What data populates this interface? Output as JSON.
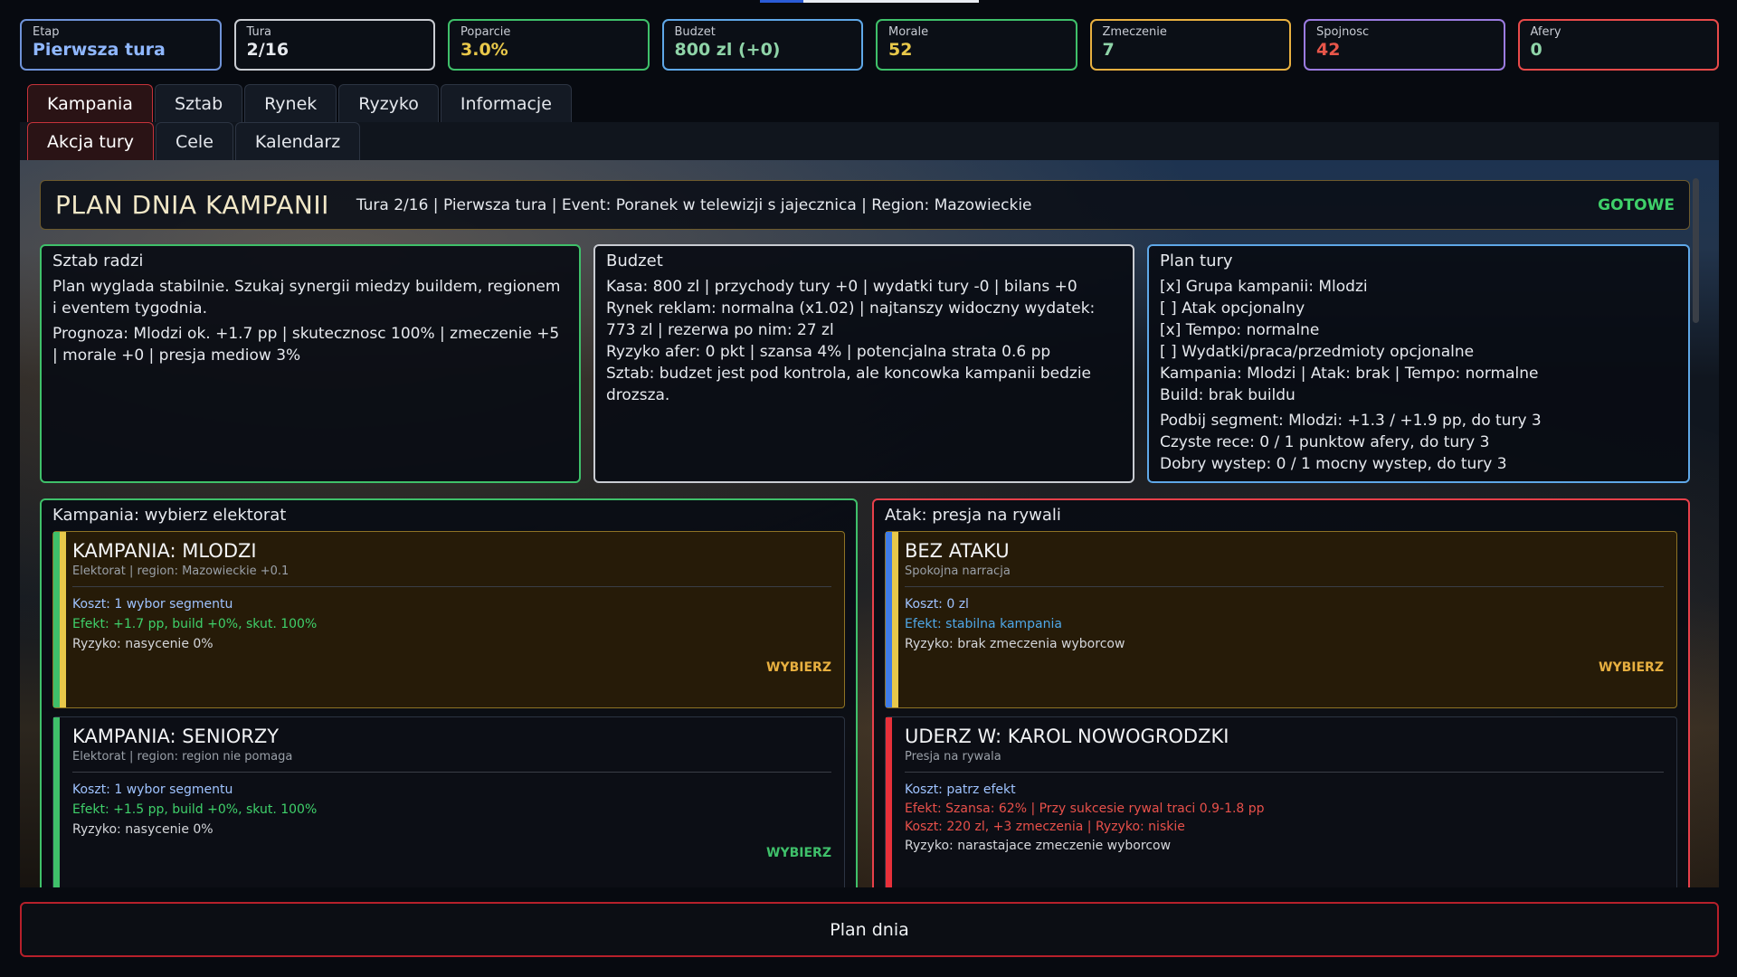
{
  "stats": [
    {
      "label": "Etap",
      "value": "Pierwsza tura",
      "border": "#6f93d8",
      "color": "#8fb7ff"
    },
    {
      "label": "Tura",
      "value": "2/16",
      "border": "#c9ccd2",
      "color": "#e6e9ee"
    },
    {
      "label": "Poparcie",
      "value": "3.0%",
      "border": "#3fc06a",
      "color": "#e8c84a"
    },
    {
      "label": "Budzet",
      "value": "800 zl (+0)",
      "border": "#5fa8e8",
      "color": "#8fd4a8"
    },
    {
      "label": "Morale",
      "value": "52",
      "border": "#3fc06a",
      "color": "#e8c84a"
    },
    {
      "label": "Zmeczenie",
      "value": "7",
      "border": "#e8b040",
      "color": "#8fd4a8"
    },
    {
      "label": "Spojnosc",
      "value": "42",
      "border": "#9b7be0",
      "color": "#e8564a"
    },
    {
      "label": "Afery",
      "value": "0",
      "border": "#e84a4a",
      "color": "#8fd4a8"
    }
  ],
  "tabs": {
    "main": [
      "Kampania",
      "Sztab",
      "Rynek",
      "Ryzyko",
      "Informacje"
    ],
    "sub": [
      "Akcja tury",
      "Cele",
      "Kalendarz"
    ]
  },
  "header": {
    "title": "PLAN DNIA KAMPANII",
    "info": "Tura 2/16 | Pierwsza tura | Event: Poranek w telewizji s jajecznica | Region: Mazowieckie",
    "status": "GOTOWE"
  },
  "advice": {
    "title": "Sztab radzi",
    "p1": "Plan wyglada stabilnie. Szukaj synergii miedzy buildem, regionem i eventem tygodnia.",
    "p2": "Prognoza: Mlodzi ok. +1.7 pp | skutecznosc 100% | zmeczenie +5 | morale +0 | presja mediow 3%"
  },
  "budget": {
    "title": "Budzet",
    "p1": "Kasa: 800 zl | przychody tury +0 | wydatki tury -0 | bilans +0",
    "p2": "Rynek reklam: normalna (x1.02) | najtanszy widoczny wydatek: 773 zl | rezerwa po nim: 27 zl",
    "p3": "Ryzyko afer: 0 pkt | szansa 4% | potencjalna strata 0.6 pp",
    "p4": "Sztab: budzet jest pod kontrola, ale koncowka kampanii bedzie drozsza."
  },
  "plan": {
    "title": "Plan tury",
    "lines": [
      "[x] Grupa kampanii: Mlodzi",
      "[ ] Atak opcjonalny",
      "[x] Tempo: normalne",
      "[ ] Wydatki/praca/przedmioty opcjonalne",
      "Kampania: Mlodzi | Atak: brak | Tempo: normalne",
      "Build: brak buildu"
    ],
    "goals": [
      "Podbij segment: Mlodzi: +1.3 / +1.9 pp, do tury 3",
      "Czyste rece: 0 / 1 punktow afery, do tury 3",
      "Dobry wystep: 0 / 1 mocny wystep, do tury 3"
    ]
  },
  "campaign": {
    "title": "Kampania: wybierz elektorat",
    "cards": [
      {
        "title": "KAMPANIA: MLODZI",
        "sub": "Elektorat | region: Mazowieckie +0.1",
        "cost": "Koszt: 1 wybor segmentu",
        "effect": "Efekt: +1.7 pp, build +0%, skut. 100%",
        "risk": "Ryzyko: nasycenie 0%",
        "pick": "WYBIERZ"
      },
      {
        "title": "KAMPANIA: SENIORZY",
        "sub": "Elektorat | region: region nie pomaga",
        "cost": "Koszt: 1 wybor segmentu",
        "effect": "Efekt: +1.5 pp, build +0%, skut. 100%",
        "risk": "Ryzyko: nasycenie 0%",
        "pick": "WYBIERZ"
      }
    ]
  },
  "attack": {
    "title": "Atak: presja na rywali",
    "cards": [
      {
        "title": "BEZ ATAKU",
        "sub": "Spokojna narracja",
        "cost": "Koszt: 0 zl",
        "effect": "Efekt: stabilna kampania",
        "risk": "Ryzyko: brak zmeczenia wyborcow",
        "pick": "WYBIERZ"
      },
      {
        "title": "UDERZ W: KAROL NOWOGRODZKI",
        "sub": "Presja na rywala",
        "cost": "Koszt: patrz efekt",
        "effect": "Efekt: Szansa: 62% | Przy sukcesie rywal traci 0.9-1.8 pp",
        "effect2": "Koszt: 220 zl, +3 zmeczenia | Ryzyko: niskie",
        "risk": "Ryzyko: narastajace zmeczenie wyborcow"
      }
    ]
  },
  "footer": {
    "label": "Plan dnia"
  }
}
